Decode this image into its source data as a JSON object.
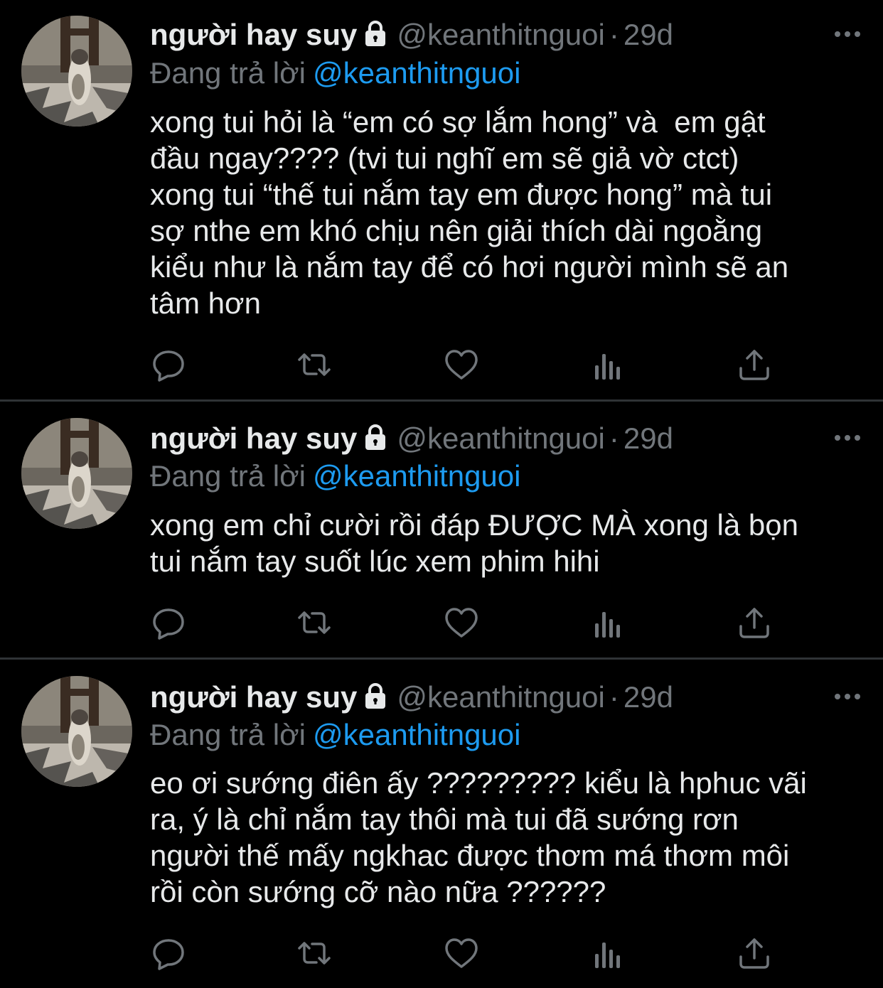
{
  "tweets": [
    {
      "name": "người hay suy",
      "handle": "@keanthitnguoi",
      "separator": "·",
      "time": "29d",
      "reply_prefix": "Đang trả lời",
      "reply_to": "@keanthitnguoi",
      "text": "xong tui hỏi là “em có sợ lắm hong” và  em gật\nđầu ngay???? (tvi tui nghĩ em sẽ giả vờ ctct)\nxong tui “thế tui nắm tay em được hong” mà tui\nsợ nthe em khó chịu nên giải thích dài ngoằng\nkiểu như là nắm tay để có hơi người mình sẽ an\ntâm hơn"
    },
    {
      "name": "người hay suy",
      "handle": "@keanthitnguoi",
      "separator": "·",
      "time": "29d",
      "reply_prefix": "Đang trả lời",
      "reply_to": "@keanthitnguoi",
      "text": "xong em chỉ cười rồi đáp ĐƯỢC MÀ xong là bọn\ntui nắm tay suốt lúc xem phim hihi"
    },
    {
      "name": "người hay suy",
      "handle": "@keanthitnguoi",
      "separator": "·",
      "time": "29d",
      "reply_prefix": "Đang trả lời",
      "reply_to": "@keanthitnguoi",
      "text": "eo ơi sướng điên ấy ????????? kiểu là hphuc vãi\nra, ý là chỉ nắm tay thôi mà tui đã sướng rơn\nngười thế mấy ngkhac được thơm má thơm môi\nrồi còn sướng cỡ nào nữa ??????"
    }
  ],
  "icons": {
    "lock": "lock-icon",
    "more": "more-horizontal-icon",
    "reply": "reply-icon",
    "retweet": "retweet-icon",
    "like": "heart-icon",
    "views": "analytics-icon",
    "share": "share-icon"
  },
  "colors": {
    "background": "#000000",
    "text": "#e7e9ea",
    "muted": "#71767b",
    "link": "#1d9bf0",
    "divider": "#2f3336"
  }
}
